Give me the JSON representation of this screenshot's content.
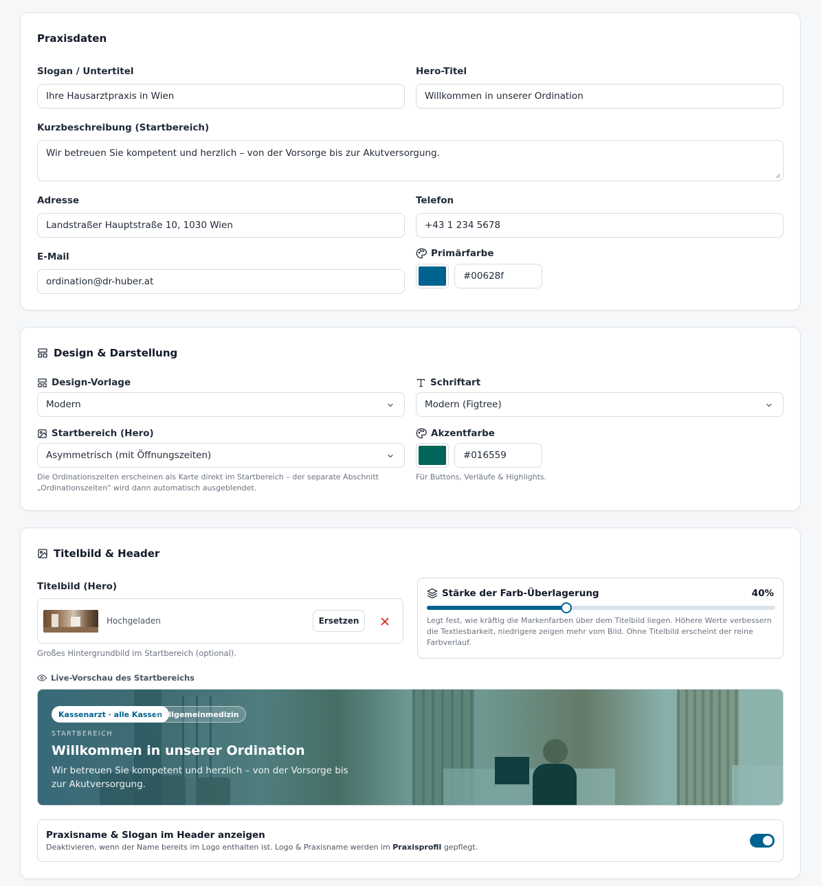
{
  "colors": {
    "primary": "#00628f",
    "accent": "#016559",
    "remove": "#dc2626"
  },
  "praxisdaten": {
    "title": "Praxisdaten",
    "slogan": {
      "label": "Slogan / Untertitel",
      "value": "Ihre Hausarztpraxis in Wien"
    },
    "hero_title": {
      "label": "Hero-Titel",
      "value": "Willkommen in unserer Ordination"
    },
    "description": {
      "label": "Kurzbeschreibung (Startbereich)",
      "value": "Wir betreuen Sie kompetent und herzlich – von der Vorsorge bis zur Akutversorgung."
    },
    "address": {
      "label": "Adresse",
      "value": "Landstraßer Hauptstraße 10, 1030 Wien"
    },
    "phone": {
      "label": "Telefon",
      "value": "+43 1 234 5678"
    },
    "email": {
      "label": "E-Mail",
      "value": "ordination@dr-huber.at"
    },
    "primary_color": {
      "label": "Primärfarbe",
      "value": "#00628f",
      "icon": "palette-icon"
    }
  },
  "design": {
    "title": "Design & Darstellung",
    "icon": "layout-icon",
    "template": {
      "label": "Design-Vorlage",
      "value": "Modern",
      "icon": "layout-icon"
    },
    "font": {
      "label": "Schriftart",
      "value": "Modern (Figtree)",
      "icon": "type-icon"
    },
    "hero": {
      "label": "Startbereich (Hero)",
      "value": "Asymmetrisch (mit Öffnungszeiten)",
      "icon": "image-icon",
      "hint": "Die Ordinationszeiten erscheinen als Karte direkt im Startbereich – der separate Abschnitt „Ordinationszeiten\" wird dann automatisch ausgeblendet."
    },
    "accent_color": {
      "label": "Akzentfarbe",
      "value": "#016559",
      "icon": "palette-icon",
      "hint": "Für Buttons, Verläufe & Highlights."
    }
  },
  "titelbild": {
    "title": "Titelbild & Header",
    "icon": "image-icon",
    "hero_image": {
      "label": "Titelbild (Hero)",
      "status": "Hochgeladen",
      "replace_label": "Ersetzen",
      "remove_icon": "close-icon",
      "hint": "Großes Hintergrundbild im Startbereich (optional)."
    },
    "overlay": {
      "label": "Stärke der Farb-Überlagerung",
      "icon": "layers-icon",
      "value_label": "40%",
      "value": 0.4,
      "hint": "Legt fest, wie kräftig die Markenfarben über dem Titelbild liegen. Höhere Werte verbessern die Textlesbarkeit, niedrigere zeigen mehr vom Bild. Ohne Titelbild erscheint der reine Farbverlauf."
    },
    "preview": {
      "label": "Live-Vorschau des Startbereichs",
      "icon": "eye-icon",
      "badges": [
        "Kassenarzt · alle Kassen",
        "Allgemeinmedizin"
      ],
      "eyebrow": "STARTBEREICH",
      "title": "Willkommen in unserer Ordination",
      "text": "Wir betreuen Sie kompetent und herzlich – von der Vorsorge bis zur Akutversorgung."
    },
    "header_toggle": {
      "title": "Praxisname & Slogan im Header anzeigen",
      "desc_before": "Deaktivieren, wenn der Name bereits im Logo enthalten ist. Logo & Praxisname werden im ",
      "desc_link": "Praxisprofil",
      "desc_after": " gepflegt.",
      "enabled": true
    }
  }
}
